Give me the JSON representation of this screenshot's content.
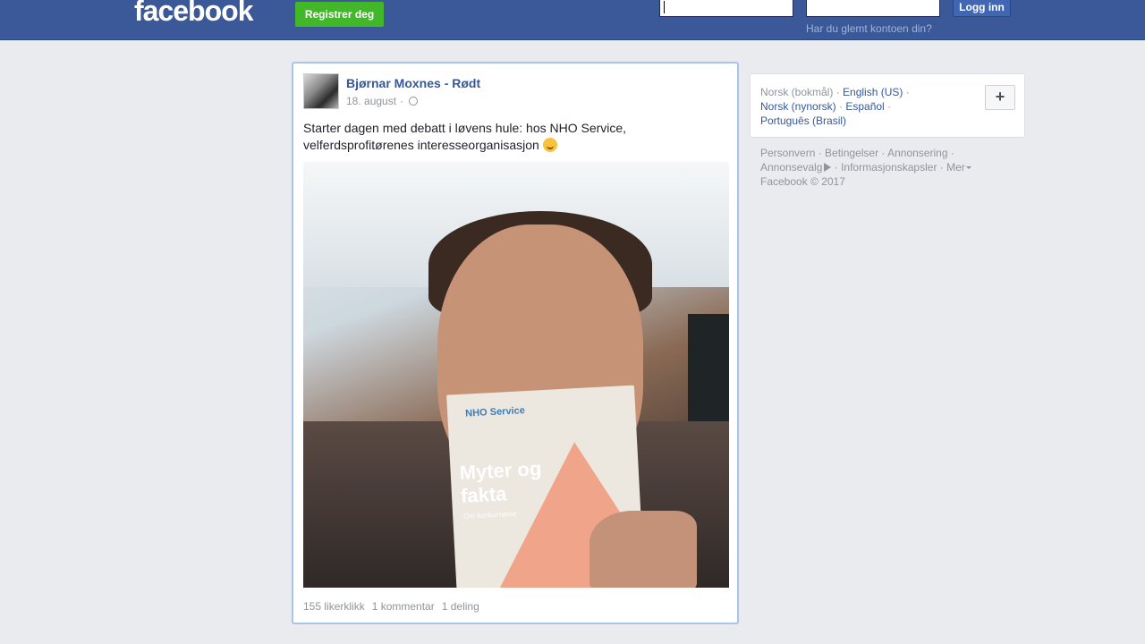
{
  "header": {
    "logo": "facebook",
    "register_label": "Registrer deg",
    "login_label": "Logg inn",
    "forgot_label": "Har du glemt kontoen din?"
  },
  "post": {
    "author": "Bjørnar Moxnes - Rødt",
    "date": "18. august",
    "separator": "·",
    "text": "Starter dagen med debatt i løvens hule: hos NHO Service, velferdsprofitørenes interesseorganisasjon",
    "photo_book": {
      "brand": "NHO Service",
      "title_line1": "Myter og",
      "title_line2": "fakta",
      "subtitle": "Om konkurranse"
    },
    "stats": {
      "likes": "155 likerklikk",
      "comments": "1 kommentar",
      "shares": "1 deling"
    }
  },
  "languages": {
    "current": "Norsk (bokmål)",
    "links": [
      "English (US)",
      "Norsk (nynorsk)",
      "Español",
      "Português (Brasil)"
    ],
    "more_label": "+"
  },
  "footer": {
    "links": [
      "Personvern",
      "Betingelser",
      "Annonsering",
      "Annonsevalg",
      "Informasjonskapsler",
      "Mer"
    ],
    "copyright": "Facebook © 2017"
  },
  "colors": {
    "header_bg": "#3b5998",
    "register_green": "#42b72a",
    "link_blue": "#365899",
    "page_bg": "#e9ebee"
  },
  "icons": [
    "globe-icon",
    "smile-emoji-icon",
    "adchoices-icon",
    "caret-down-icon",
    "plus-icon"
  ]
}
